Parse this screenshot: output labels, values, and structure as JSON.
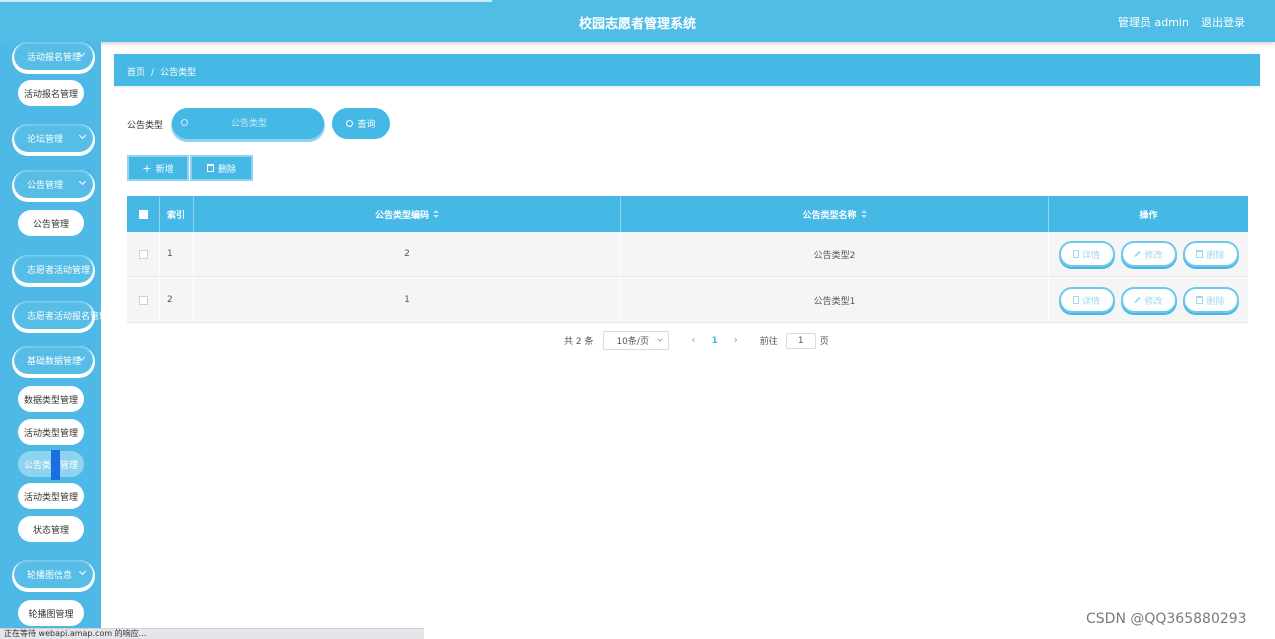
{
  "header": {
    "title": "校园志愿者管理系统",
    "user": "管理员 admin",
    "logout": "退出登录",
    "color": "#50bde6"
  },
  "sidebar": {
    "menus": [
      {
        "label": "活动报名管理",
        "icon": "chevron-down-icon"
      },
      {
        "label": "论坛管理",
        "icon": "chevron-down-icon"
      },
      {
        "label": "公告管理",
        "icon": "chevron-down-icon"
      },
      {
        "label": "志愿者活动管理"
      },
      {
        "label": "志愿者活动报名管理"
      },
      {
        "label": "基础数据管理",
        "icon": "chevron-down-icon"
      },
      {
        "label": "轮播图信息",
        "icon": "chevron-down-icon"
      }
    ],
    "subs": [
      {
        "label": "活动报名管理"
      },
      {
        "label": "公告管理"
      },
      {
        "label": "数据类型管理"
      },
      {
        "label": "活动类型管理"
      },
      {
        "label": "公告类型管理",
        "active": true
      },
      {
        "label": "活动类型管理"
      },
      {
        "label": "状态管理"
      },
      {
        "label": "轮播图管理"
      }
    ]
  },
  "breadcrumb": {
    "home": "首页",
    "separator": "/",
    "current": "公告类型"
  },
  "search": {
    "label": "公告类型",
    "placeholder": "公告类型",
    "button": "查询"
  },
  "toolbar": {
    "add": "新增",
    "delete": "删除"
  },
  "table": {
    "columns": [
      "索引",
      "公告类型编码",
      "公告类型名称",
      "操作"
    ],
    "rows": [
      {
        "index": "1",
        "code": "2",
        "name": "公告类型2"
      },
      {
        "index": "2",
        "code": "1",
        "name": "公告类型1"
      }
    ],
    "actions": {
      "detail": "详情",
      "edit": "修改",
      "delete": "删除"
    }
  },
  "pagination": {
    "total": "共 2 条",
    "page_size": "10条/页",
    "current_page": "1",
    "goto_label": "前往",
    "goto_value": "1",
    "page_suffix": "页"
  },
  "status_bar": "正在等待 webapi.amap.com 的响应...",
  "watermark": "CSDN @QQ365880293"
}
